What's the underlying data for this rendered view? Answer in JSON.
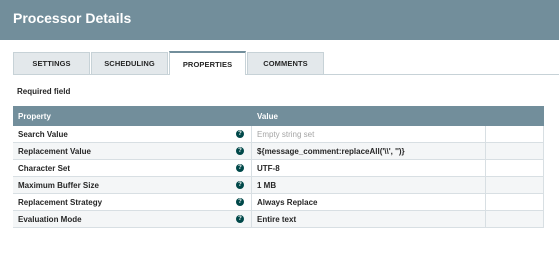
{
  "dialog": {
    "title": "Processor Details"
  },
  "tabs": [
    {
      "label": "SETTINGS",
      "active": false
    },
    {
      "label": "SCHEDULING",
      "active": false
    },
    {
      "label": "PROPERTIES",
      "active": true
    },
    {
      "label": "COMMENTS",
      "active": false
    }
  ],
  "required_label": "Required field",
  "table": {
    "headers": {
      "property": "Property",
      "value": "Value"
    },
    "rows": [
      {
        "property": "Search Value",
        "value": "Empty string set",
        "empty": true
      },
      {
        "property": "Replacement Value",
        "value": "${message_comment:replaceAll('\\\\', '')}",
        "empty": false
      },
      {
        "property": "Character Set",
        "value": "UTF-8",
        "empty": false
      },
      {
        "property": "Maximum Buffer Size",
        "value": "1 MB",
        "empty": false
      },
      {
        "property": "Replacement Strategy",
        "value": "Always Replace",
        "empty": false
      },
      {
        "property": "Evaluation Mode",
        "value": "Entire text",
        "empty": false
      }
    ]
  },
  "icons": {
    "help": "help-icon"
  },
  "colors": {
    "header": "#728e9b",
    "help_icon": "#004849",
    "placeholder": "#a5a5a5"
  }
}
